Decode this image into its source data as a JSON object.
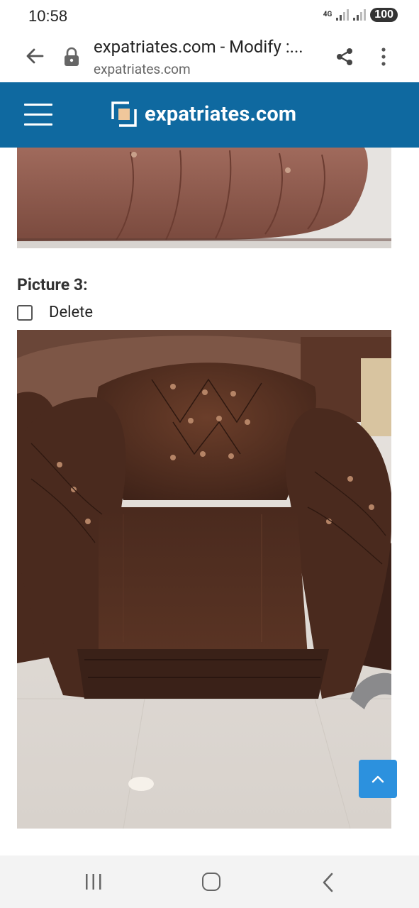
{
  "status_bar": {
    "time": "10:58",
    "network": "4G",
    "battery": "100",
    "icons": [
      "signal-icon",
      "signal-icon",
      "battery-icon"
    ]
  },
  "browser": {
    "title": "expatriates.com - Modify :...",
    "domain": "expatriates.com",
    "icons": [
      "back-arrow-icon",
      "lock-icon",
      "share-icon",
      "more-vert-icon"
    ]
  },
  "site": {
    "logo_text": "expatriates.com",
    "header_color": "#0f69a0",
    "icons": [
      "hamburger-menu-icon",
      "logo-mark-icon"
    ]
  },
  "content": {
    "picture_label": "Picture 3:",
    "delete_label": "Delete",
    "delete_checked": false,
    "top_photo_alt": "brown leather tufted sofa cushion",
    "main_photo_alt": "brown leather chesterfield armchair"
  },
  "scroll_top": {
    "icon": "chevron-up-icon",
    "color": "#2c91de"
  },
  "nav": {
    "icons": [
      "recents-icon",
      "home-icon",
      "back-icon"
    ]
  }
}
